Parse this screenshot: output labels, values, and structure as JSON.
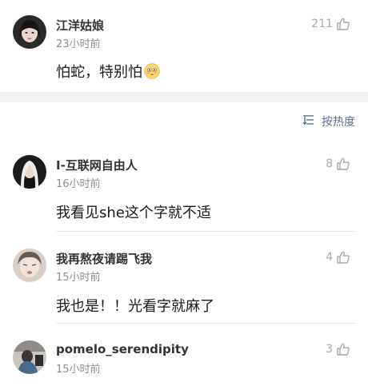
{
  "featured": {
    "username": "江洋姑娘",
    "time": "23小时前",
    "likes": "211",
    "content": "怕蛇，特别怕",
    "emoji": "flushed-face"
  },
  "sort": {
    "label": "按热度",
    "icon": "sort-icon"
  },
  "comments": [
    {
      "username": "I-互联网自由人",
      "time": "16小时前",
      "likes": "8",
      "content": "我看见she这个字就不适"
    },
    {
      "username": "我再熬夜请踢飞我",
      "time": "15小时前",
      "likes": "4",
      "content": "我也是！！光看字就麻了"
    },
    {
      "username": "pomelo_serendipity",
      "time": "15小时前",
      "likes": "3"
    }
  ],
  "colors": {
    "link": "#5b6f8f",
    "muted": "#8e8e8e",
    "gap": "#f2f2f2"
  }
}
